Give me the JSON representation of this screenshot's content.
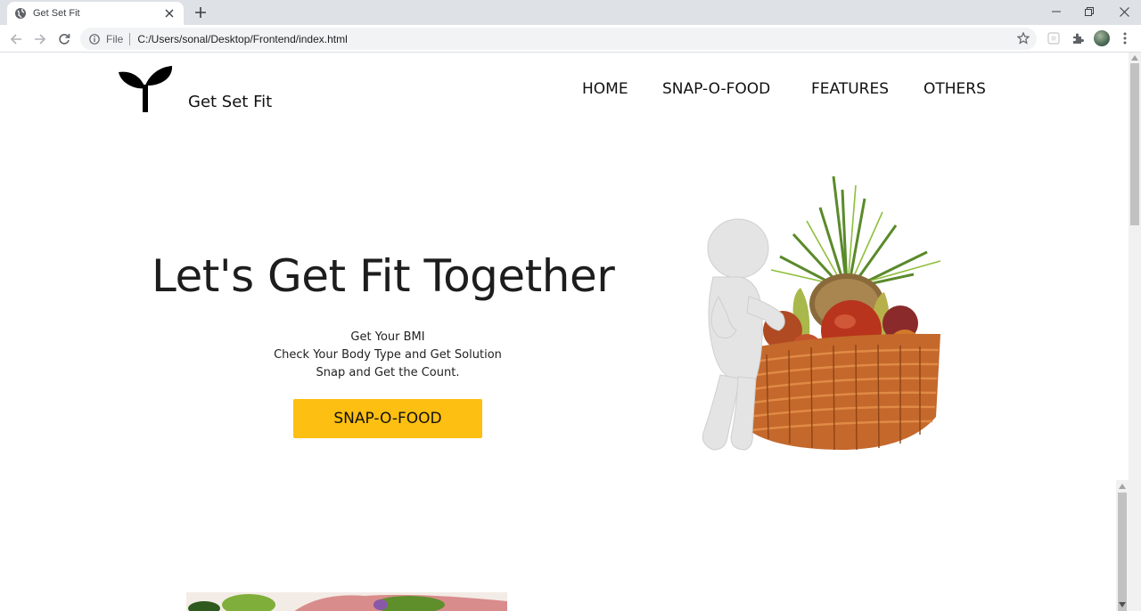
{
  "browser": {
    "tab_title": "Get Set Fit",
    "scheme": "File",
    "url": "C:/Users/sonal/Desktop/Frontend/index.html"
  },
  "site": {
    "brand": "Get Set Fit",
    "nav": [
      "HOME",
      "SNAP-O-FOOD",
      "FEATURES",
      "OTHERS"
    ]
  },
  "hero": {
    "title": "Let's Get Fit Together",
    "lines": [
      "Get Your BMI",
      "Check Your Body Type and Get Solution",
      "Snap and Get the Count."
    ],
    "cta": "SNAP-O-FOOD"
  },
  "icons": {
    "favicon": "globe-icon",
    "logo": "sprout-logo",
    "extensions": "puzzle-icon"
  },
  "colors": {
    "cta": "#fdbf11",
    "text": "#1d1d1d",
    "chrome_tabstrip": "#dee1e6"
  }
}
